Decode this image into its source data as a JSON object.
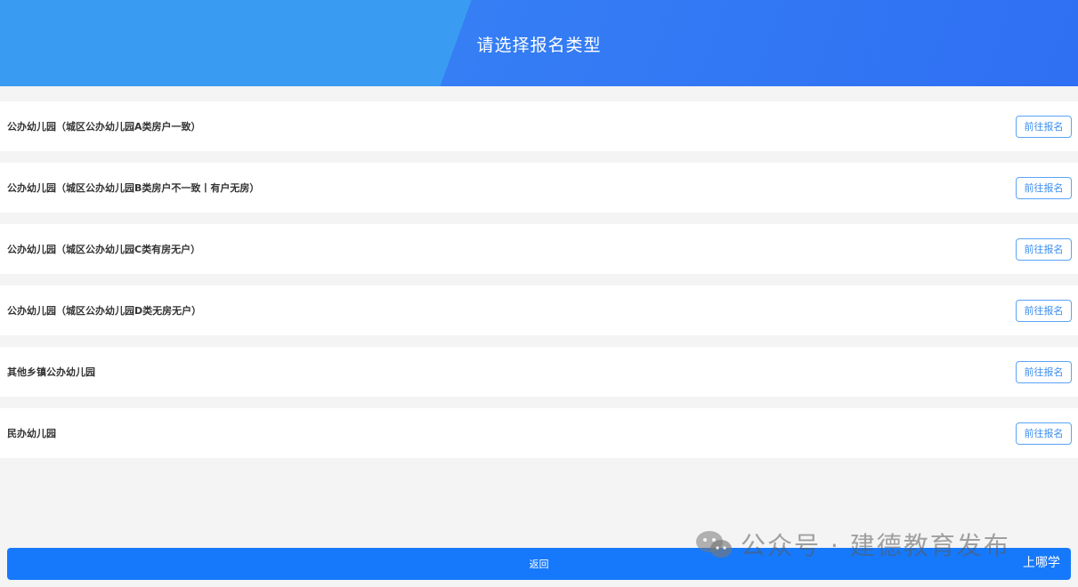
{
  "header": {
    "title": "请选择报名类型"
  },
  "items": [
    {
      "label": "公办幼儿园（城区公办幼儿园A类房户一致）",
      "button": "前往报名"
    },
    {
      "label": "公办幼儿园（城区公办幼儿园B类房户不一致丨有户无房）",
      "button": "前往报名"
    },
    {
      "label": "公办幼儿园（城区公办幼儿园C类有房无户）",
      "button": "前往报名"
    },
    {
      "label": "公办幼儿园（城区公办幼儿园D类无房无户）",
      "button": "前往报名"
    },
    {
      "label": "其他乡镇公办幼儿园",
      "button": "前往报名"
    },
    {
      "label": "民办幼儿园",
      "button": "前往报名"
    }
  ],
  "footer": {
    "back_label": "返回"
  },
  "watermark": {
    "text": "公众号 · 建德教育发布",
    "icon": "wechat-icon",
    "corner": "上哪学"
  },
  "colors": {
    "header_left": "#3a9bf2",
    "header_right": "#2f6ff3",
    "button_border": "#5aa3f5",
    "back_bar": "#1679fb"
  }
}
